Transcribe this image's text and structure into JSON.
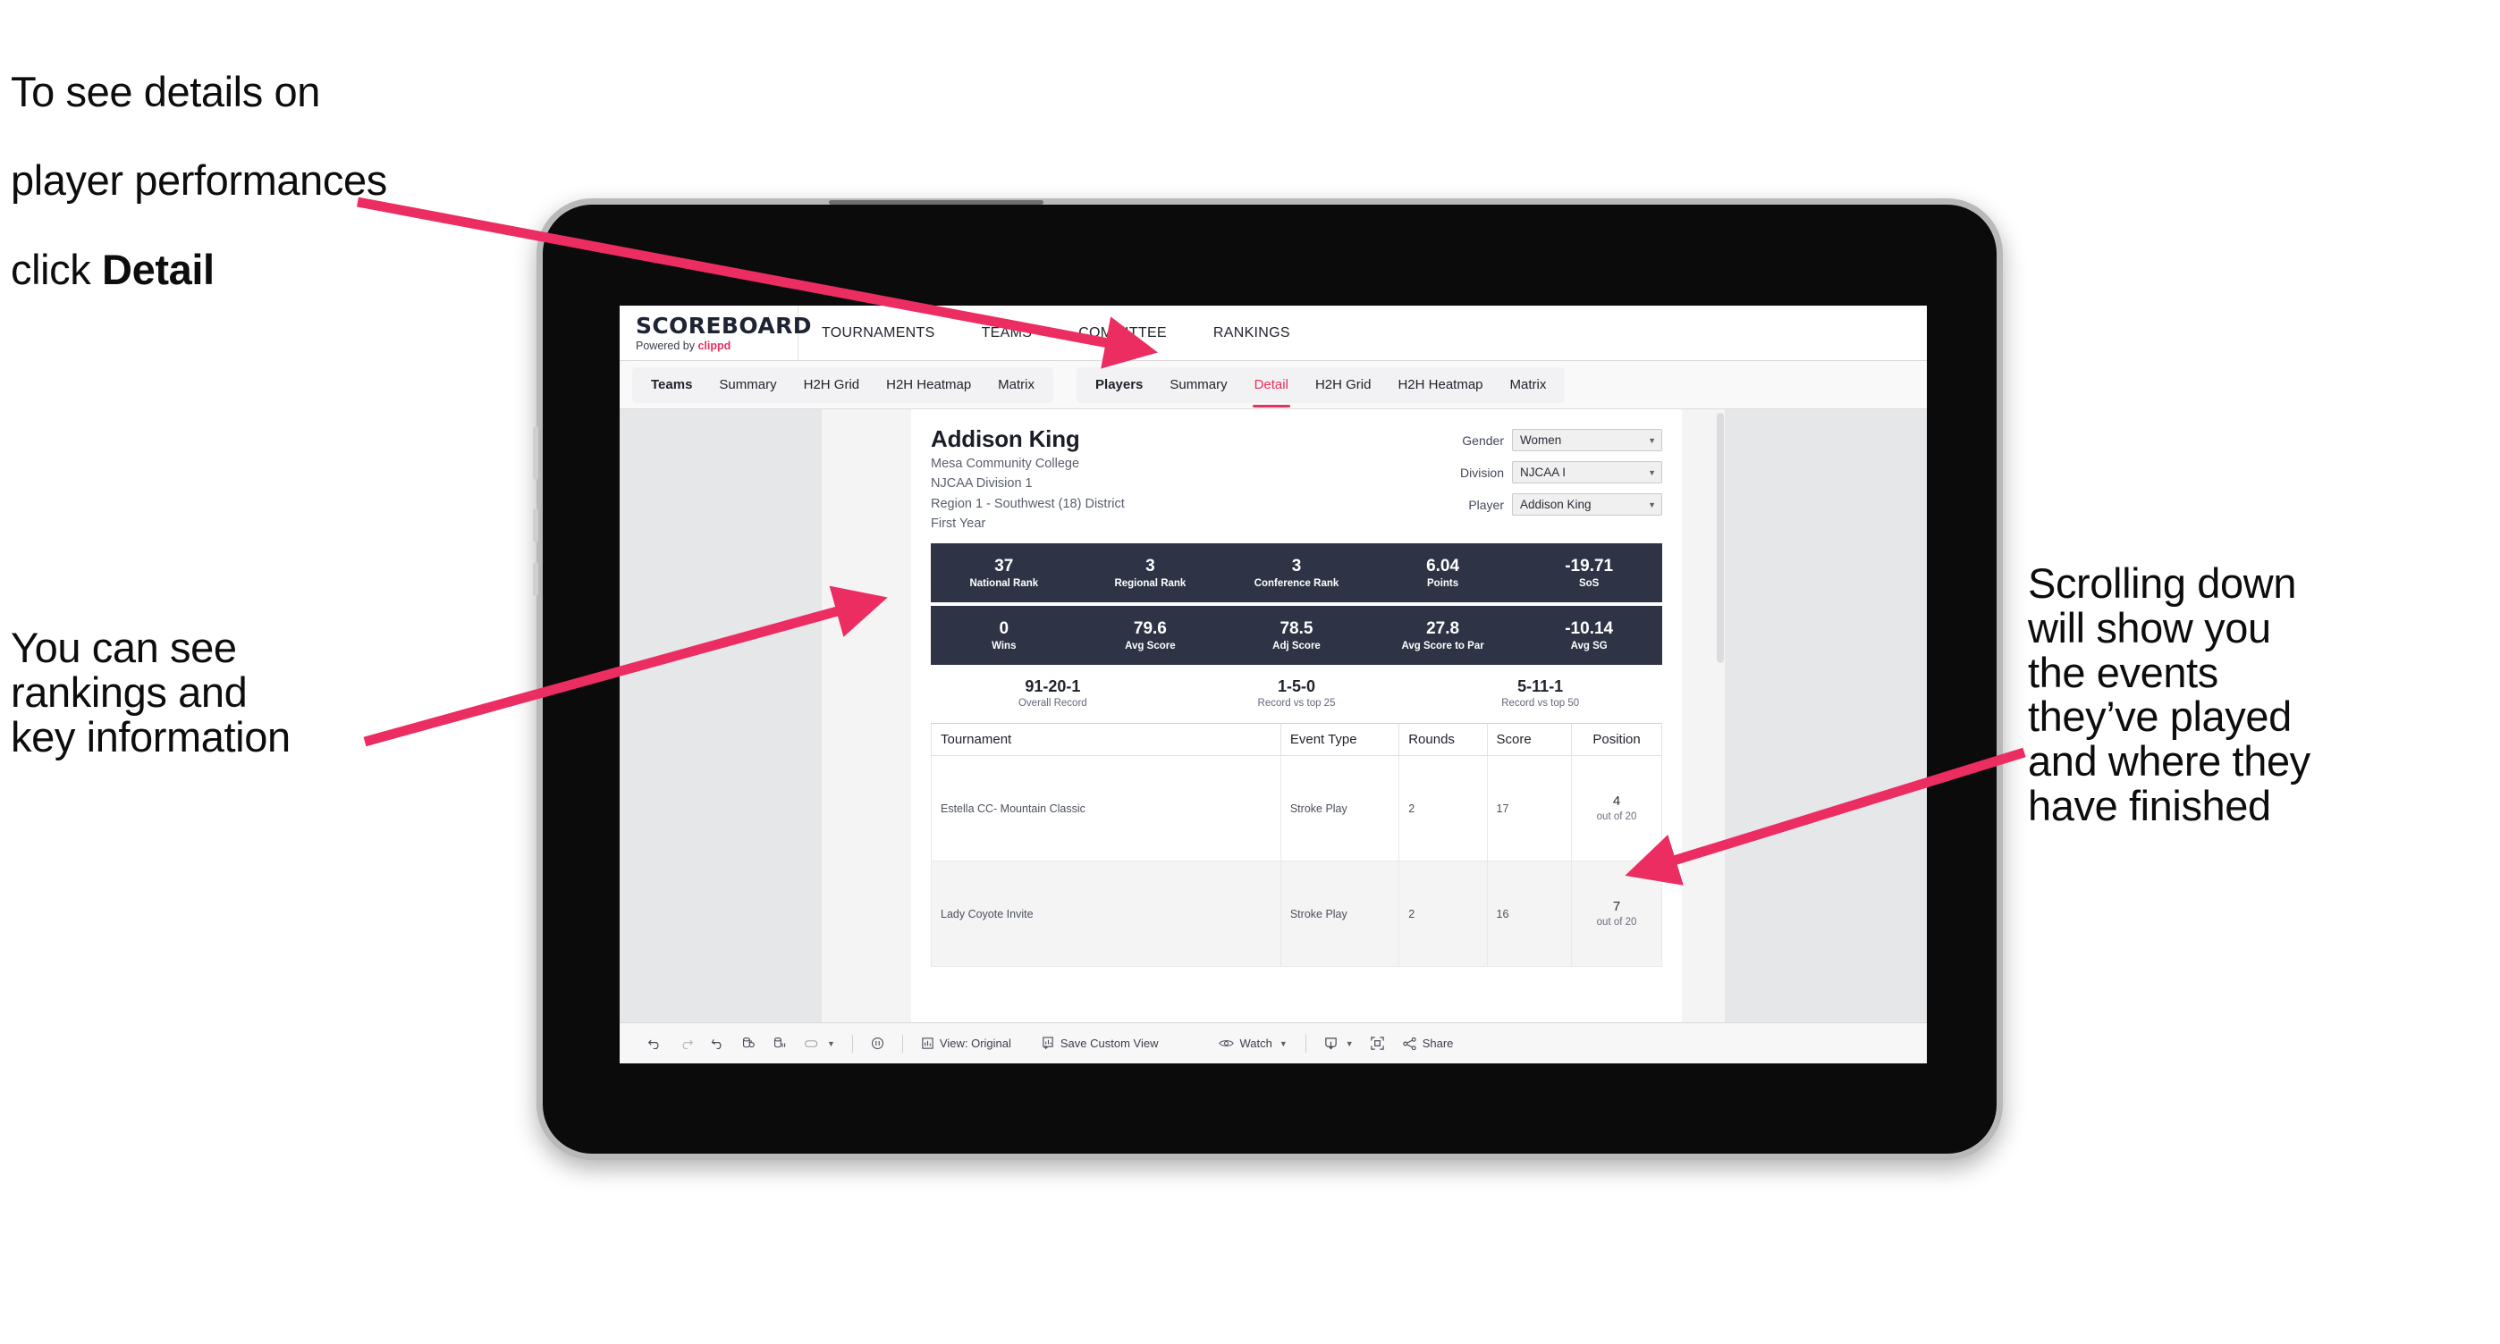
{
  "annotations": {
    "detail": {
      "line1": "To see details on",
      "line2": "player performances",
      "line3_pre": "click ",
      "line3_bold": "Detail"
    },
    "rankings": "You can see\nrankings and\nkey information",
    "scrolling": "Scrolling down\nwill show you\nthe events\nthey’ve played\nand where they\nhave finished"
  },
  "colors": {
    "accent": "#e8305c",
    "stat_bar": "#2e3446",
    "screen_bg": "#e6e7e9"
  },
  "app": {
    "brand": {
      "title": "SCOREBOARD",
      "sub_prefix": "Powered by ",
      "sub_brand": "clippd"
    },
    "top_nav": [
      "TOURNAMENTS",
      "TEAMS",
      "COMMITTEE",
      "RANKINGS"
    ],
    "tab_groups": [
      {
        "lead": "Teams",
        "tabs": [
          "Summary",
          "H2H Grid",
          "H2H Heatmap",
          "Matrix"
        ],
        "active": null
      },
      {
        "lead": "Players",
        "tabs": [
          "Summary",
          "Detail",
          "H2H Grid",
          "H2H Heatmap",
          "Matrix"
        ],
        "active": "Detail"
      }
    ]
  },
  "player": {
    "name": "Addison King",
    "school": "Mesa Community College",
    "division": "NJCAA Division 1",
    "region": "Region 1 - Southwest (18) District",
    "year": "First Year"
  },
  "filters": [
    {
      "label": "Gender",
      "value": "Women"
    },
    {
      "label": "Division",
      "value": "NJCAA I"
    },
    {
      "label": "Player",
      "value": "Addison King"
    }
  ],
  "stats_row1": [
    {
      "value": "37",
      "label": "National Rank"
    },
    {
      "value": "3",
      "label": "Regional Rank"
    },
    {
      "value": "3",
      "label": "Conference Rank"
    },
    {
      "value": "6.04",
      "label": "Points"
    },
    {
      "value": "-19.71",
      "label": "SoS"
    }
  ],
  "stats_row2": [
    {
      "value": "0",
      "label": "Wins"
    },
    {
      "value": "79.6",
      "label": "Avg Score"
    },
    {
      "value": "78.5",
      "label": "Adj Score"
    },
    {
      "value": "27.8",
      "label": "Avg Score to Par"
    },
    {
      "value": "-10.14",
      "label": "Avg SG"
    }
  ],
  "records": [
    {
      "value": "91-20-1",
      "label": "Overall Record"
    },
    {
      "value": "1-5-0",
      "label": "Record vs top 25"
    },
    {
      "value": "5-11-1",
      "label": "Record vs top 50"
    }
  ],
  "table": {
    "headers": [
      "Tournament",
      "Event Type",
      "Rounds",
      "Score",
      "Position"
    ],
    "rows": [
      {
        "tournament": "Estella CC- Mountain Classic",
        "event_type": "Stroke Play",
        "rounds": "2",
        "score": "17",
        "position": "4",
        "position_sub": "out of 20"
      },
      {
        "tournament": "Lady Coyote Invite",
        "event_type": "Stroke Play",
        "rounds": "2",
        "score": "16",
        "position": "7",
        "position_sub": "out of 20"
      }
    ]
  },
  "toolbar": {
    "view_label": "View: Original",
    "save_label": "Save Custom View",
    "watch_label": "Watch",
    "share_label": "Share"
  }
}
